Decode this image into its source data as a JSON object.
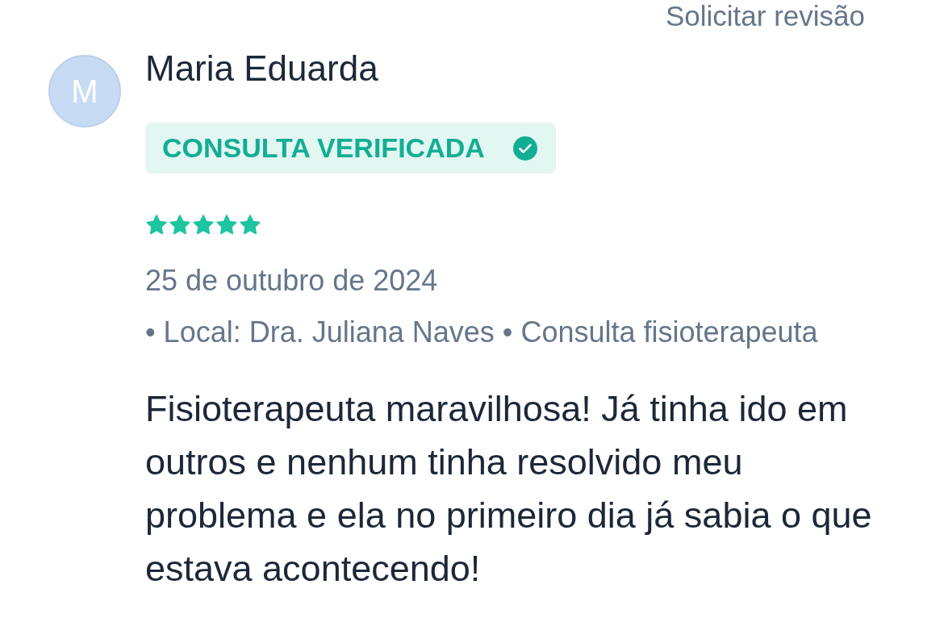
{
  "header": {
    "link": "Solicitar revisão"
  },
  "review": {
    "avatar": {
      "initial": "M"
    },
    "author": "Maria Eduarda",
    "badge": {
      "label": "CONSULTA VERIFICADA",
      "verified": true
    },
    "stars": 5,
    "date": "25 de outubro de 2024",
    "details": "• Local: Dra. Juliana Naves • Consulta fisioterapeuta",
    "text": "Fisioterapeuta maravilhosa! Já tinha ido em outros e nenhum tinha resolvido meu problema e ela no primeiro dia já sabia o que estava acontecendo!"
  }
}
